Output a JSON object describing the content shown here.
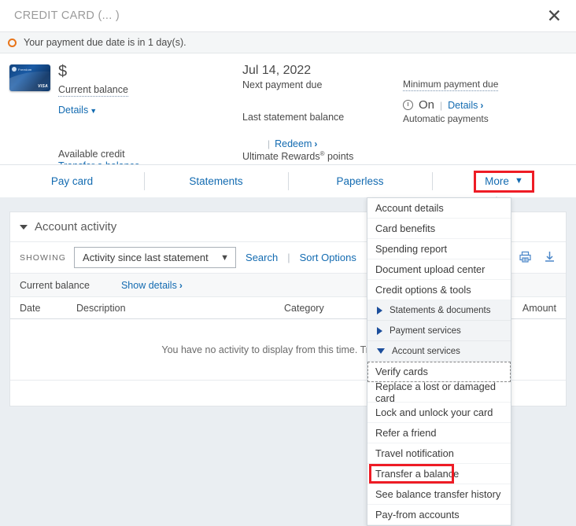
{
  "titlebar": {
    "title": "CREDIT CARD (...        )",
    "close_icon": "close-icon"
  },
  "alert": {
    "icon": "alert-circle-icon",
    "text": "Your payment due date is in 1 day(s)."
  },
  "summary": {
    "balance": {
      "amount": "$",
      "label": "Current balance",
      "details_link": "Details",
      "available_credit_label": "Available credit",
      "transfer_link": "Transfer a balance"
    },
    "payment": {
      "next_date": "Jul 14, 2022",
      "next_label": "Next payment due",
      "last_statement_label": "Last statement balance",
      "redeem_link": "Redeem",
      "rewards_label_pre": "Ultimate Rewards",
      "rewards_sup": "®",
      "rewards_label_post": " points"
    },
    "minimum": {
      "label": "Minimum payment due",
      "auto_state": "On",
      "auto_details_link": "Details",
      "auto_label": "Automatic payments",
      "auto_icon": "auto-payment-clock-icon"
    }
  },
  "tabs": [
    {
      "label": "Pay card"
    },
    {
      "label": "Statements"
    },
    {
      "label": "Paperless"
    },
    {
      "label": "More"
    }
  ],
  "more_menu": {
    "items": [
      {
        "label": "Account details",
        "type": "item"
      },
      {
        "label": "Card benefits",
        "type": "item"
      },
      {
        "label": "Spending report",
        "type": "item"
      },
      {
        "label": "Document upload center",
        "type": "item"
      },
      {
        "label": "Credit options & tools",
        "type": "item"
      },
      {
        "label": "Statements & documents",
        "type": "group",
        "expanded": false
      },
      {
        "label": "Payment services",
        "type": "group",
        "expanded": false
      },
      {
        "label": "Account services",
        "type": "group",
        "expanded": true
      },
      {
        "label": "Verify cards",
        "type": "item",
        "focused": true
      },
      {
        "label": "Replace a lost or damaged card",
        "type": "item"
      },
      {
        "label": "Lock and unlock your card",
        "type": "item"
      },
      {
        "label": "Refer a friend",
        "type": "item"
      },
      {
        "label": "Travel notification",
        "type": "item"
      },
      {
        "label": "Transfer a balance",
        "type": "item",
        "highlighted": true
      },
      {
        "label": "See balance transfer history",
        "type": "item"
      },
      {
        "label": "Pay-from accounts",
        "type": "item"
      }
    ]
  },
  "activity": {
    "title": "Account activity",
    "showing_label": "SHOWING",
    "filter_value": "Activity since last statement",
    "search_link": "Search",
    "sort_link": "Sort Options",
    "print_icon": "print-icon",
    "download_icon": "download-icon",
    "balance_label": "Current balance",
    "show_details_link": "Show details",
    "columns": [
      "Date",
      "Description",
      "Category",
      "Amount"
    ],
    "empty_message": "You have no activity to display from this time. Try updating",
    "rows": []
  },
  "colors": {
    "link": "#136bb1",
    "highlight": "#ee1c25",
    "alert": "#e8751a",
    "page_bg": "#eaeef2"
  }
}
